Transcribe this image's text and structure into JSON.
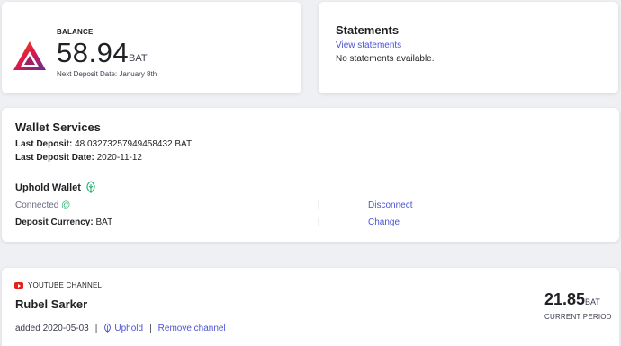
{
  "balance": {
    "label": "BALANCE",
    "amount": "58.94",
    "unit": "BAT",
    "next_deposit": "Next Deposit Date: January 8th"
  },
  "statements": {
    "title": "Statements",
    "link": "View statements",
    "empty_text": "No statements available."
  },
  "wallet": {
    "title": "Wallet Services",
    "last_deposit_label": "Last Deposit:",
    "last_deposit_value": "48.03273257949458432 BAT",
    "last_deposit_date_label": "Last Deposit Date:",
    "last_deposit_date_value": "2020-11-12",
    "uphold_title": "Uphold Wallet",
    "connected_label": "Connected",
    "connected_at": "@",
    "pipe": "|",
    "disconnect": "Disconnect",
    "deposit_currency_label": "Deposit Currency:",
    "deposit_currency_value": "BAT",
    "change": "Change"
  },
  "channel": {
    "type_label": "YOUTUBE CHANNEL",
    "name": "Rubel Sarker",
    "added": "added 2020-05-03",
    "sep": "|",
    "uphold_link": "Uphold",
    "remove_link": "Remove channel",
    "amount": "21.85",
    "unit": "BAT",
    "period": "CURRENT PERIOD"
  },
  "colors": {
    "link": "#4c54d2",
    "accent_green": "#2bb374",
    "youtube_red": "#e62117"
  },
  "icons": {
    "bat": "bat-logo-icon",
    "uphold": "uphold-leaf-icon",
    "youtube": "youtube-icon"
  }
}
